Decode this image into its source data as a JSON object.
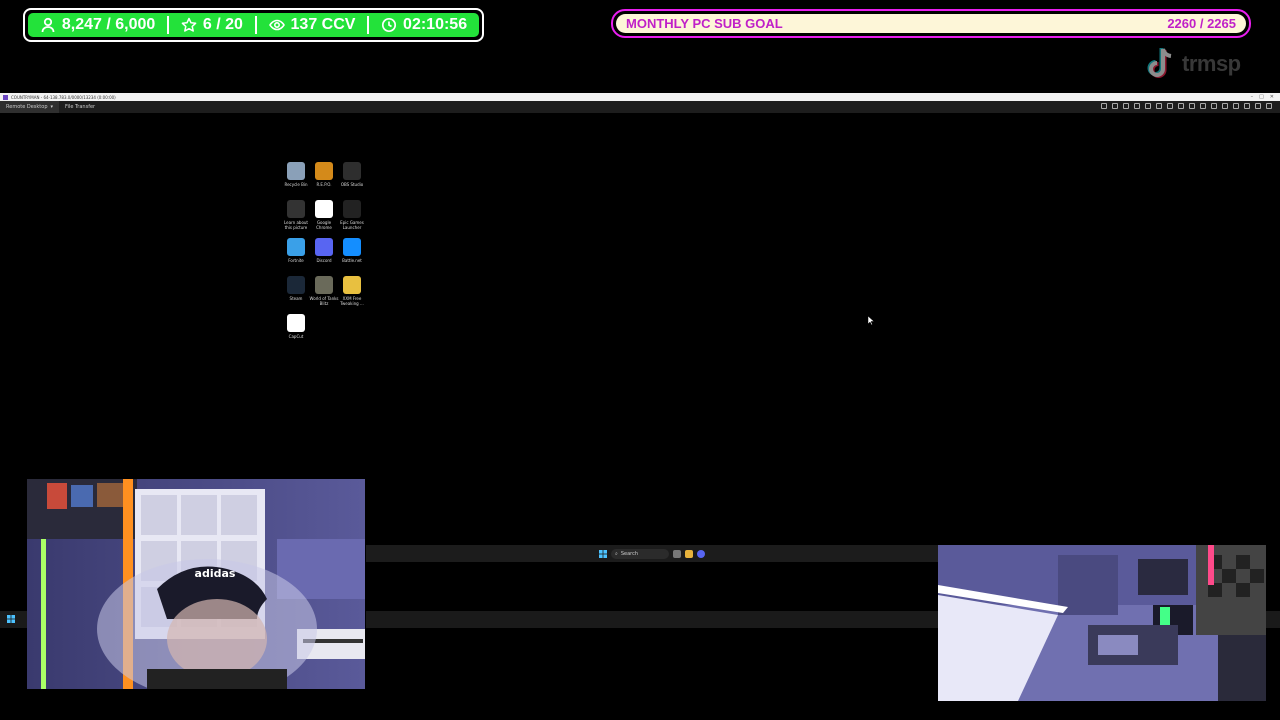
{
  "stats": {
    "followers": "8,247 / 6,000",
    "favorites": "6 / 20",
    "viewers": "137 CCV",
    "timer": "02:10:56"
  },
  "sub_goal": {
    "title": "MONTHLY PC SUB GOAL",
    "progress": "2260 / 2265",
    "fraction": 0.9978
  },
  "tiktok": {
    "handle": "trmsp"
  },
  "remote_window": {
    "title_text": "COUNTRYMAN - 64-138.783.0/0000/13234 (0:00:00)",
    "tabs": [
      "Remote Desktop",
      "File Transfer"
    ]
  },
  "desktop_icons": [
    {
      "label": "Recycle Bin",
      "icon": "recycle-bin-icon",
      "color": "#8aa0b8"
    },
    {
      "label": "R.E.P.O.",
      "icon": "repo-game-icon",
      "color": "#d48a1a"
    },
    {
      "label": "OBS Studio",
      "icon": "obs-icon",
      "color": "#2e2e2e"
    },
    {
      "label": "Learn about this picture",
      "icon": "camera-icon",
      "color": "#333333"
    },
    {
      "label": "Google Chrome",
      "icon": "chrome-icon",
      "color": "#ffffff"
    },
    {
      "label": "Epic Games Launcher",
      "icon": "epic-games-icon",
      "color": "#222222"
    },
    {
      "label": "Fortnite",
      "icon": "fortnite-icon",
      "color": "#3aa0e8"
    },
    {
      "label": "Discord",
      "icon": "discord-icon",
      "color": "#5865f2"
    },
    {
      "label": "Battle.net",
      "icon": "battlenet-icon",
      "color": "#148eff"
    },
    {
      "label": "Steam",
      "icon": "steam-icon",
      "color": "#1b2838"
    },
    {
      "label": "World of Tanks Blitz",
      "icon": "wot-blitz-icon",
      "color": "#6a6a5a"
    },
    {
      "label": "XXM Free Tweaking ...",
      "icon": "folder-icon",
      "color": "#e8c040"
    },
    {
      "label": "CapCut",
      "icon": "capcut-icon",
      "color": "#ffffff"
    }
  ],
  "taskbar": {
    "search_placeholder": "Search"
  },
  "colors": {
    "stats_green": "#23e23a",
    "goal_border": "#e91ef0",
    "goal_fill": "#fdf6d8",
    "goal_text": "#c020c8"
  }
}
